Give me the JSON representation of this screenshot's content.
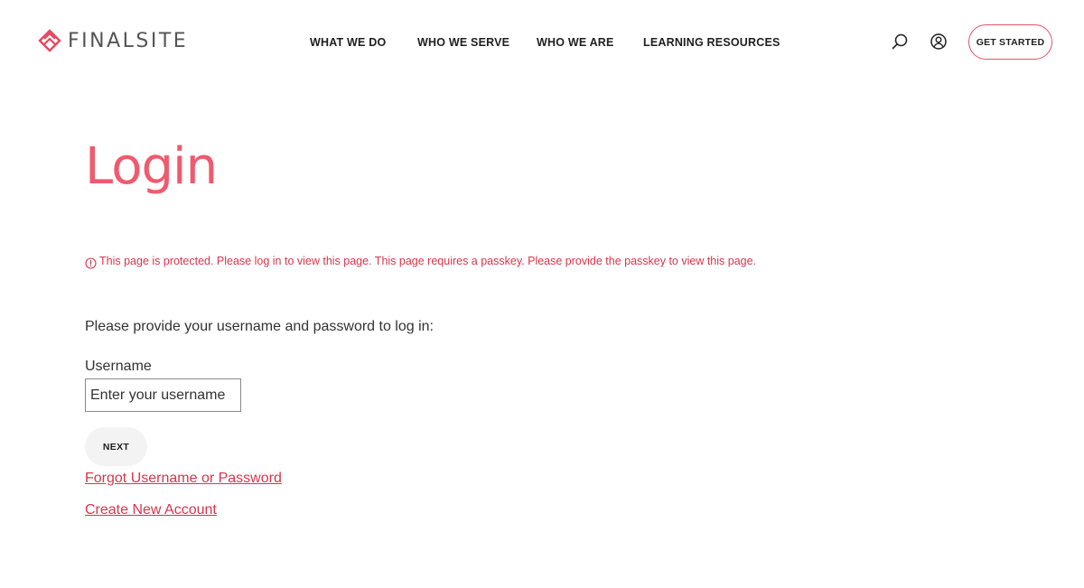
{
  "brand": {
    "name": "FINALSITE",
    "accent_color": "#f05a6e",
    "logo_icon": "finalsite-diamond-logo"
  },
  "nav": {
    "items": [
      {
        "label": "WHAT WE DO"
      },
      {
        "label": "WHO WE SERVE"
      },
      {
        "label": "WHO WE ARE"
      },
      {
        "label": "LEARNING RESOURCES"
      }
    ],
    "search_icon": "search-icon",
    "account_icon": "user-circle-icon",
    "cta_label": "GET STARTED"
  },
  "main": {
    "title": "Login",
    "alert": {
      "icon": "alert-circle-icon",
      "text": "This page is protected. Please log in to view this page. This page requires a passkey. Please provide the passkey to view this page.",
      "color": "#d9354d"
    },
    "instructions": "Please provide your username and password to log in:",
    "username": {
      "label": "Username",
      "placeholder": "Enter your username",
      "value": ""
    },
    "next_label": "NEXT",
    "links": {
      "forgot": "Forgot Username or Password",
      "create": "Create New Account"
    }
  }
}
